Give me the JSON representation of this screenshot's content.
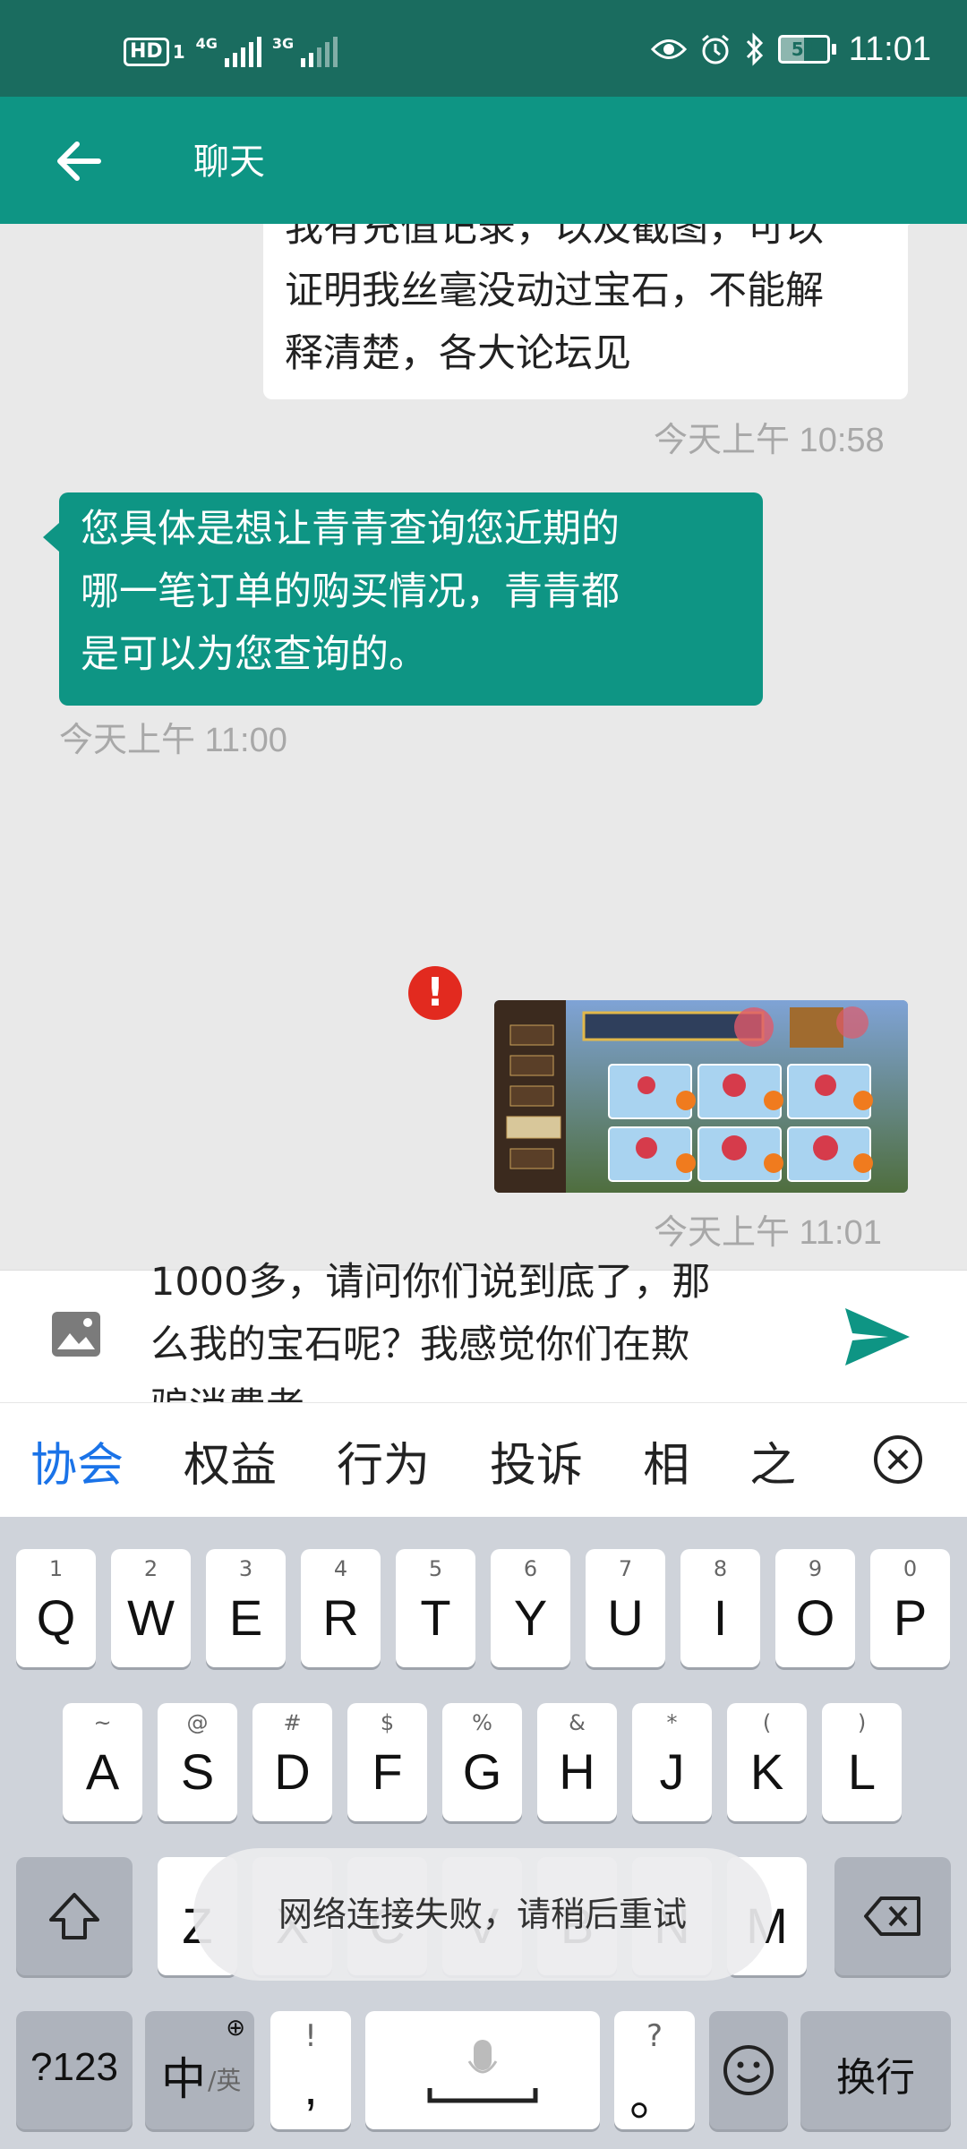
{
  "status_bar": {
    "hd_label": "HD",
    "sim1_label": "1",
    "sig1_label": "4G",
    "sig2_label": "3G",
    "battery": "51",
    "time": "11:01",
    "icons": [
      "eye-icon",
      "alarm-icon",
      "bluetooth-icon",
      "battery-icon"
    ]
  },
  "app_bar": {
    "title": "聊天"
  },
  "messages": [
    {
      "direction": "out",
      "text": "我有充值记录，以及截图，可以\n证明我丝毫没动过宝石，不能解\n释清楚，各大论坛见",
      "time": "今天上午 10:58"
    },
    {
      "direction": "in",
      "text": "您具体是想让青青查询您近期的\n哪一笔订单的购买情况，青青都\n是可以为您查询的。",
      "time": "今天上午 11:00"
    },
    {
      "direction": "out",
      "type": "image",
      "status": "failed",
      "error_mark": "!",
      "time": "今天上午 11:01"
    }
  ],
  "input": {
    "text": "1000多，请问你们说到底了，那\n么我的宝石呢？我感觉你们在欺\n骗消费者"
  },
  "suggestions": [
    "协会",
    "权益",
    "行为",
    "投诉",
    "相",
    "之"
  ],
  "keyboard": {
    "row1": [
      {
        "hint": "1",
        "key": "Q"
      },
      {
        "hint": "2",
        "key": "W"
      },
      {
        "hint": "3",
        "key": "E"
      },
      {
        "hint": "4",
        "key": "R"
      },
      {
        "hint": "5",
        "key": "T"
      },
      {
        "hint": "6",
        "key": "Y"
      },
      {
        "hint": "7",
        "key": "U"
      },
      {
        "hint": "8",
        "key": "I"
      },
      {
        "hint": "9",
        "key": "O"
      },
      {
        "hint": "0",
        "key": "P"
      }
    ],
    "row2": [
      {
        "hint": "~",
        "key": "A"
      },
      {
        "hint": "@",
        "key": "S"
      },
      {
        "hint": "#",
        "key": "D"
      },
      {
        "hint": "$",
        "key": "F"
      },
      {
        "hint": "%",
        "key": "G"
      },
      {
        "hint": "&",
        "key": "H"
      },
      {
        "hint": "*",
        "key": "J"
      },
      {
        "hint": "(",
        "key": "K"
      },
      {
        "hint": ")",
        "key": "L"
      }
    ],
    "row3": [
      {
        "hint": "",
        "key": "Z"
      },
      {
        "hint": "",
        "key": "X"
      },
      {
        "hint": "",
        "key": "C"
      },
      {
        "hint": "",
        "key": "V"
      },
      {
        "hint": "",
        "key": "B"
      },
      {
        "hint": "",
        "key": "N"
      },
      {
        "hint": "",
        "key": "M"
      }
    ],
    "num_key": "?123",
    "lang_main": "中",
    "lang_sub": "/英",
    "comma_hint": "!",
    "comma_key": ",",
    "period_hint": "?",
    "period_key": "。",
    "enter_key": "换行"
  },
  "toast": "网络连接失败，请稍后重试",
  "colors": {
    "status_bar": "#1a6c5f",
    "app_bar": "#0e9584",
    "error": "#e22a1f",
    "active_suggestion": "#1a73e8"
  }
}
